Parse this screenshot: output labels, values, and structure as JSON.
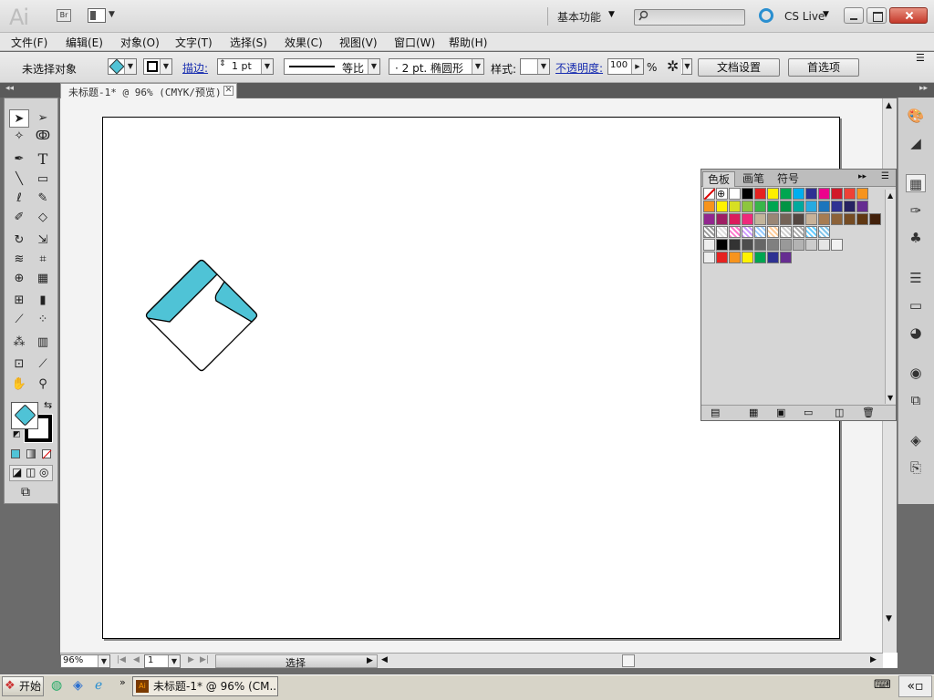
{
  "app": {
    "logo": "Ai",
    "bridge_label": "Br"
  },
  "titlebar": {
    "workspace": "基本功能",
    "cslive": "CS Live"
  },
  "menu": [
    "文件(F)",
    "编辑(E)",
    "对象(O)",
    "文字(T)",
    "选择(S)",
    "效果(C)",
    "视图(V)",
    "窗口(W)",
    "帮助(H)"
  ],
  "control": {
    "selection_status": "未选择对象",
    "stroke_label": "描边:",
    "stroke_weight": "1 pt",
    "stroke_style": "等比",
    "brush": "·  2 pt. 椭圆形",
    "style_label": "样式:",
    "opacity_label": "不透明度:",
    "opacity_value": "100",
    "opacity_unit": "%",
    "doc_setup": "文档设置",
    "preferences": "首选项"
  },
  "document": {
    "tab_title": "未标题-1* @ 96% (CMYK/预览)"
  },
  "status": {
    "zoom": "96%",
    "artboard": "1",
    "tool": "选择"
  },
  "swatch_panel": {
    "tabs": [
      "色板",
      "画笔",
      "符号"
    ]
  },
  "colors": {
    "fill": "#4fc3d6",
    "stroke": "#000000"
  },
  "taskbar": {
    "start": "开始",
    "app_task": "未标题-1* @ 96% (CM..."
  },
  "swatches": {
    "row1": [
      "#ffffff",
      "#000000",
      "#e62220",
      "#ffef00",
      "#00a650",
      "#00aeef",
      "#2e3192",
      "#ec008c",
      "#d1192a",
      "#ef4136",
      "#f7941d"
    ],
    "row2": [
      "#f7941d",
      "#fff200",
      "#d7df23",
      "#8dc63f",
      "#39b54a",
      "#00a651",
      "#009444",
      "#00a99d",
      "#27aae1",
      "#1c75bc",
      "#2e3192",
      "#262262",
      "#662d91"
    ],
    "row3": [
      "#92278f",
      "#9e1f63",
      "#da1c5c",
      "#ee2a7b",
      "#c2b59b",
      "#998675",
      "#736357",
      "#534741",
      "#c7b299",
      "#a67c52",
      "#8c6239",
      "#754c24",
      "#603813",
      "#42210b"
    ],
    "row4": [
      "#000000",
      "#333333",
      "#4d4d4d",
      "#666666",
      "#808080",
      "#999999",
      "#b3b3b3",
      "#cccccc",
      "#e6e6e6",
      "#f2f2f2"
    ],
    "row5": [
      "#e62220",
      "#f7941d",
      "#fff200",
      "#00a651",
      "#2e3192",
      "#662d91"
    ]
  }
}
